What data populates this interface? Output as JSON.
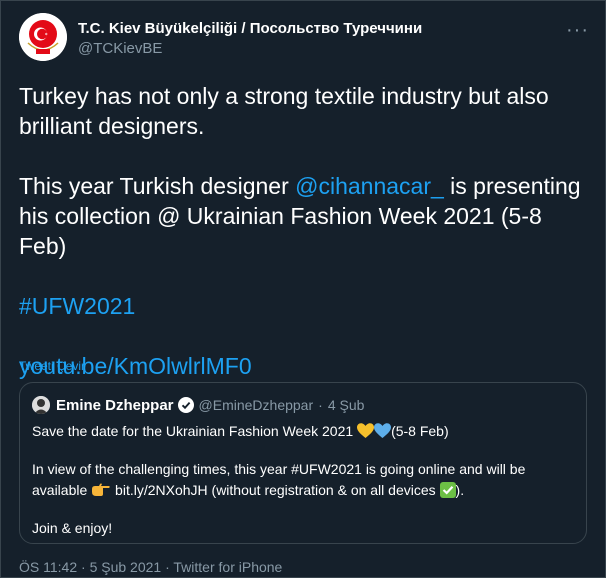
{
  "tweet": {
    "author_name": "T.C. Kiev Büyükelçiliği / Посольство Туреччини",
    "author_handle": "@TCKievBE",
    "more_label": "···",
    "line1": "Turkey has not only a strong textile industry but also",
    "line2": "brilliant designers.",
    "line3_pre": "This year Turkish designer ",
    "mention": "@cihannacar_",
    "line3_post": " is presenting",
    "line4": "his collection @ Ukrainian Fashion Week 2021 (5-8 Feb)",
    "hashtag": "#UFW2021",
    "url": "youtu.be/KmOlwlrlMF0",
    "translate_label": "Tweeti Çevir"
  },
  "quote": {
    "author_name": "Emine Dzheppar",
    "author_handle": "@EmineDzheppar",
    "separator": "·",
    "date": "4 Şub",
    "line1_pre": "Save the date for the Ukrainian Fashion Week 2021 ",
    "line1_post": "(5-8 Feb)",
    "line2": "In view of the challenging times, this year #UFW2021 is going online and will be",
    "line3_pre": "available ",
    "line3_link": "bit.ly/2NXohJH",
    "line3_post": " (without registration & on all devices ",
    "line3_end": ").",
    "line4": "Join & enjoy!"
  },
  "footer": {
    "time": "ÖS 11:42",
    "sep1": "·",
    "date": "5 Şub 2021",
    "sep2": "·",
    "source": "Twitter for iPhone"
  },
  "colors": {
    "background": "#15202b",
    "link": "#1da1f2",
    "muted": "#8899a6",
    "border": "#38444d"
  }
}
